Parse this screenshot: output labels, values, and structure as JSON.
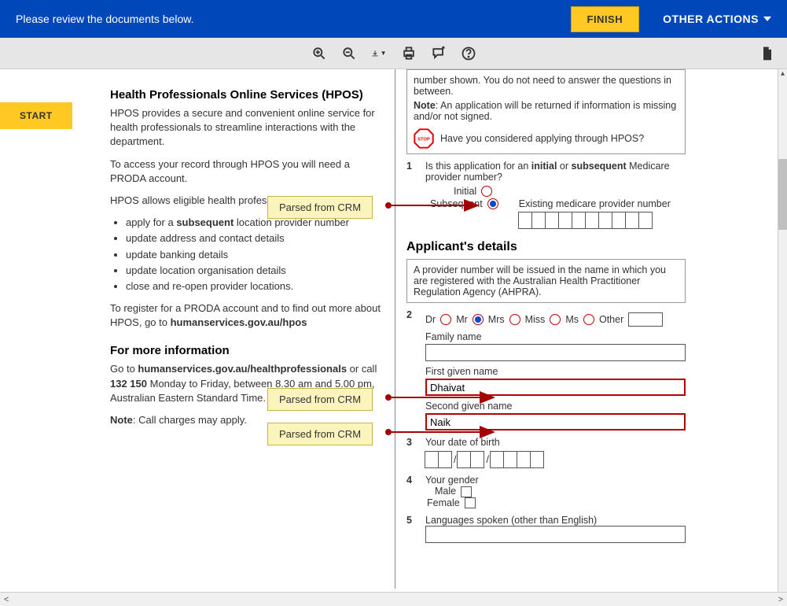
{
  "topbar": {
    "message": "Please review the documents below.",
    "finish_label": "FINISH",
    "other_actions_label": "OTHER ACTIONS"
  },
  "start_label": "START",
  "left": {
    "title": "Health Professionals Online Services (HPOS)",
    "p1": "HPOS provides a secure and convenient online service for health professionals to streamline interactions with the department.",
    "p2": "To access your record through HPOS you will need a PRODA account.",
    "p3": "HPOS allows eligible health professionals to:",
    "bullets": [
      "apply for a subsequent location provider number",
      "update address and contact details",
      "update banking details",
      "update location organisation details",
      "close and re-open provider locations."
    ],
    "p4a": "To register for a PRODA account and to find out more about HPOS, go to ",
    "p4b": "humanservices.gov.au/hpos",
    "more_title": "For more information",
    "p5a": "Go to ",
    "p5b": "humanservices.gov.au/healthprofessionals",
    "p5c": " or call ",
    "p5d": "132 150",
    "p5e": " Monday to Friday, between 8.30 am and 5.00 pm, Australian Eastern Standard Time.",
    "note_label": "Note",
    "note_text": ": Call charges may apply."
  },
  "right": {
    "top_note": "number shown. You do not need to answer the questions in between.",
    "note_label": "Note",
    "note_text": ": An application will be returned if information is missing and/or not signed.",
    "stop_q": "Have you considered applying through HPOS?",
    "q1a": "Is this application for an ",
    "q1b": "initial",
    "q1c": " or ",
    "q1d": "subsequent",
    "q1e": " Medicare provider number?",
    "initial_label": "Initial",
    "subsequent_label": "Subsequent",
    "existing_label": "Existing medicare provider number",
    "sect_applicant": "Applicant's details",
    "ahpra_note": "A provider number will be issued in the name in which you are registered with the Australian Health Practitioner Regulation Agency (AHPRA).",
    "titles": {
      "dr": "Dr",
      "mr": "Mr",
      "mrs": "Mrs",
      "miss": "Miss",
      "ms": "Ms",
      "other": "Other"
    },
    "family_label": "Family name",
    "first_label": "First given name",
    "first_value": "Dhaivat",
    "second_label": "Second given name",
    "second_value": "Naik",
    "dob_label": "Your date of birth",
    "gender_label": "Your gender",
    "male_label": "Male",
    "female_label": "Female",
    "lang_label": "Languages spoken (other than English)"
  },
  "callouts": {
    "crm1": "Parsed from CRM",
    "crm2": "Parsed from CRM",
    "crm3": "Parsed from CRM"
  }
}
